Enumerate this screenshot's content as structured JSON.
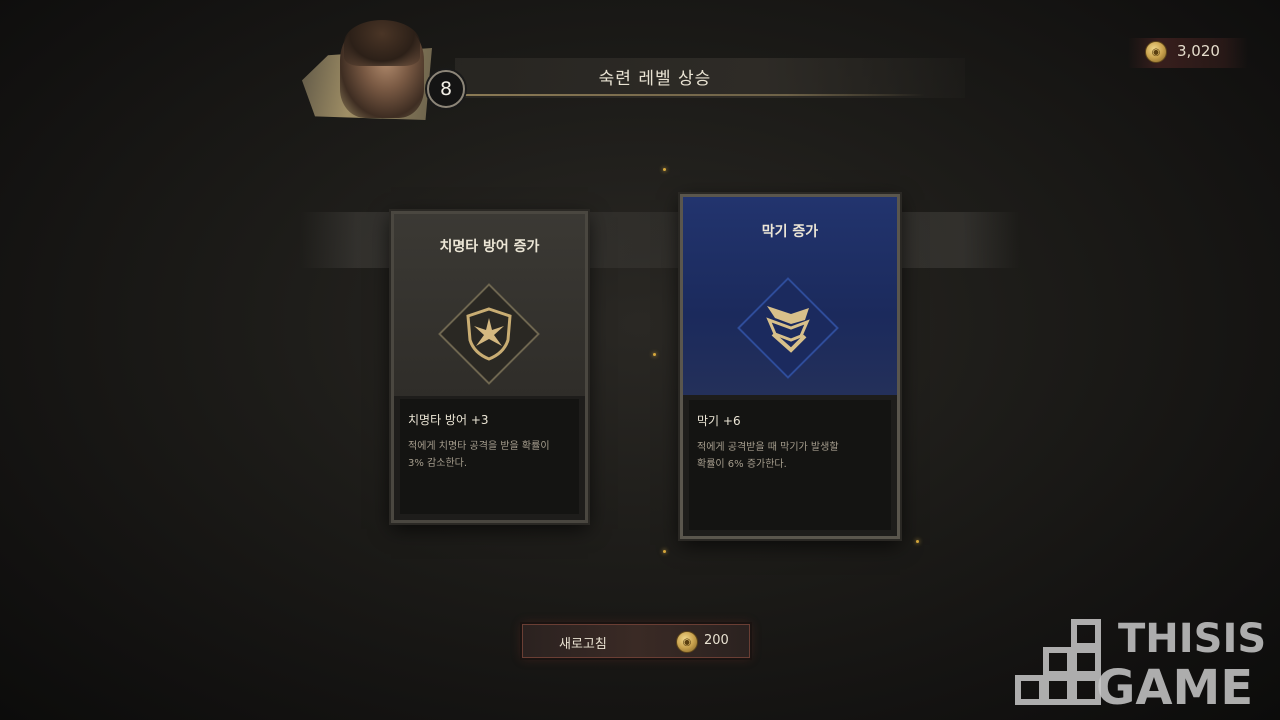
{
  "header": {
    "level": "8",
    "title": "숙련 레벨 상승"
  },
  "currency": {
    "icon": "gold-coin-icon",
    "amount": "3,020"
  },
  "cards": [
    {
      "title": "치명타 방어 증가",
      "icon": "star-shield-icon",
      "stat_name": "치명타 방어 +3",
      "description_lines": [
        "적에게 치명타 공격을 받을 확률이",
        "3% 감소한다."
      ],
      "theme_color": "#3b3934"
    },
    {
      "title": "막기 증가",
      "icon": "chevron-shield-icon",
      "stat_name": "막기 +6",
      "description_lines": [
        "적에게 공격받을 때 막기가 발생할",
        "확률이 6% 증가한다."
      ],
      "theme_color": "#22346e",
      "selected": true
    }
  ],
  "refresh": {
    "label": "새로고침",
    "icon": "gold-coin-icon",
    "cost": "200"
  },
  "watermark": {
    "line1": "THISIS",
    "line2": "GAME"
  }
}
